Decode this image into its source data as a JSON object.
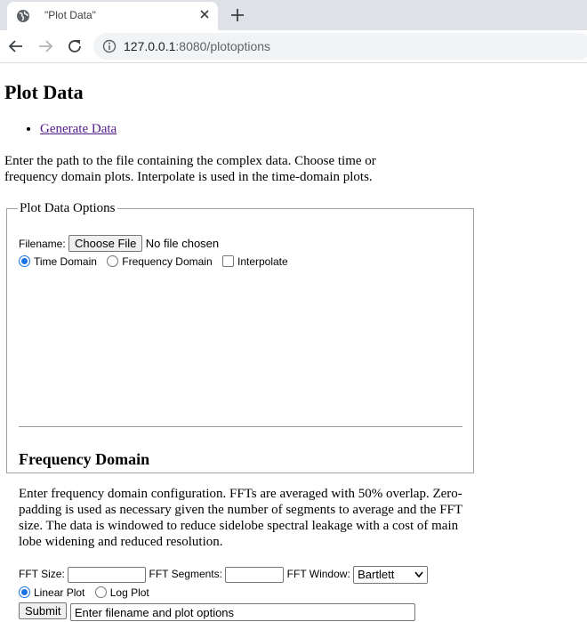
{
  "browser": {
    "tab_title": "\"Plot Data\"",
    "url_host": "127.0.0.1",
    "url_port_path": ":8080/plotoptions"
  },
  "page": {
    "heading": "Plot Data",
    "nav_link": "Generate Data",
    "intro": "Enter the path to the file containing the complex data. Choose time or frequency domain plots. Interpolate is used in the time-domain plots.",
    "fieldset_legend": "Plot Data Options",
    "filename_label": "Filename:",
    "choose_file_label": "Choose File",
    "no_file_text": "No file chosen",
    "domain_options": [
      "Time Domain",
      "Frequency Domain"
    ],
    "domain_selected": "Time Domain",
    "interpolate_label": "Interpolate",
    "interpolate_checked": false,
    "freq_heading": "Frequency Domain",
    "freq_description": "Enter frequency domain configuration. FFTs are averaged with 50% overlap. Zero-padding is used as necessary given the number of segments to average and the FFT size. The data is windowed to reduce sidelobe spectral leakage with a cost of main lobe widening and reduced resolution.",
    "fft_size_label": "FFT Size:",
    "fft_size_value": "",
    "fft_segments_label": "FFT Segments:",
    "fft_segments_value": "",
    "fft_window_label": "FFT Window:",
    "fft_window_value": "Bartlett",
    "plot_options": [
      "Linear Plot",
      "Log Plot"
    ],
    "plot_selected": "Linear Plot",
    "submit_label": "Submit",
    "status_value": "Enter filename and plot options"
  },
  "colors": {
    "accent": "#1a73e8",
    "visited_link": "#551a8b"
  }
}
